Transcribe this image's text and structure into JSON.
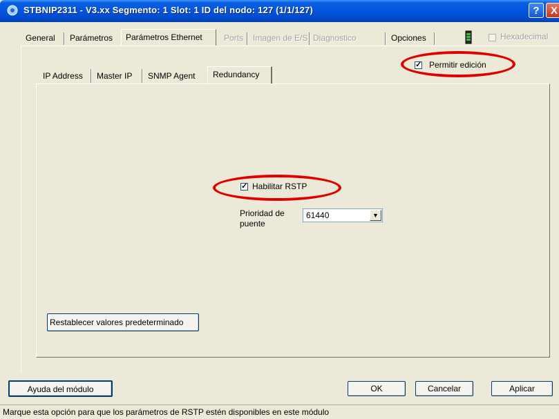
{
  "window": {
    "title": "STBNIP2311 - V3.xx Segmento: 1 Slot: 1 ID del nodo: 127 (1/1/127)",
    "help_label": "?",
    "close_label": "X"
  },
  "outer_tabs": {
    "general": "General",
    "parametros": "Parámetros",
    "parametros_ethernet": "Parámetros Ethernet",
    "ports": "Ports",
    "imagen_es": "Imagen de E/S",
    "diagnostico": "Diagnostico",
    "opciones": "Opciones"
  },
  "hexadecimal_label": "Hexadecimal",
  "inner_tabs": {
    "ip_address": "IP Address",
    "master_ip": "Master IP",
    "snmp_agent": "SNMP Agent",
    "redundancy": "Redundancy"
  },
  "permitir_edicion": {
    "label": "Permitir edición",
    "checked": true
  },
  "habilitar_rstp": {
    "label": "Habilitar RSTP",
    "checked": true
  },
  "prioridad": {
    "label_line1": "Prioridad de",
    "label_line2": "puente",
    "value": "61440"
  },
  "restore_defaults_label": "Restablecer valores predeterminado",
  "buttons": {
    "ayuda": "Ayuda del módulo",
    "ok": "OK",
    "cancelar": "Cancelar",
    "aplicar": "Aplicar"
  },
  "status_text": "Marque esta opción para que los parámetros de RSTP estén disponibles en este módulo",
  "colors": {
    "highlight_circle": "#e00000",
    "title_bar": "#0355e0",
    "dialog_bg": "#ece9d8"
  },
  "icons": [
    "app-icon",
    "help-icon",
    "close-icon",
    "battery-icon",
    "dropdown-arrow-icon",
    "check-icon"
  ]
}
